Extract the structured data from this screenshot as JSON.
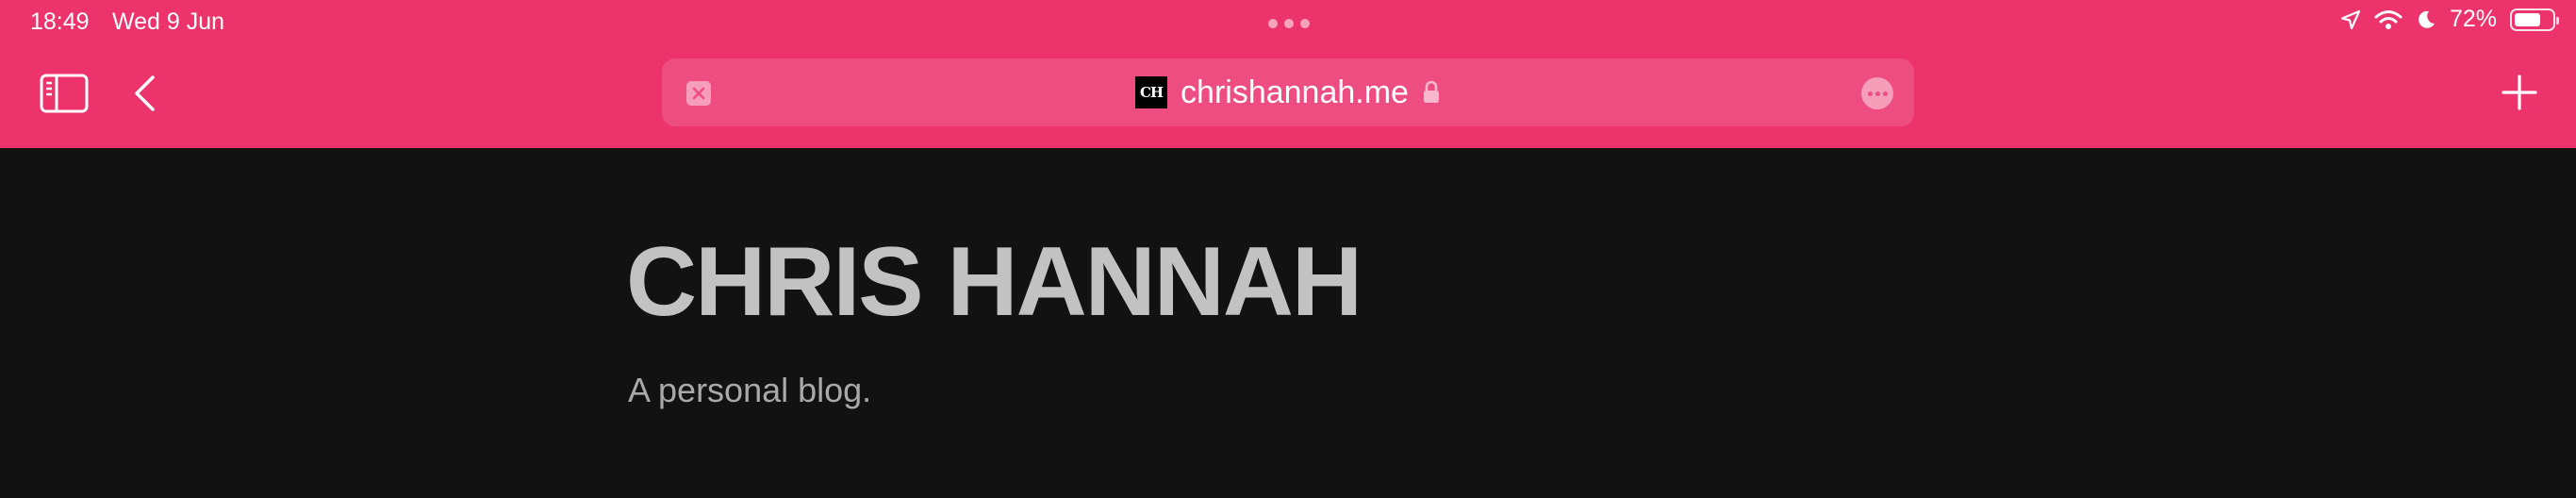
{
  "status_bar": {
    "time": "18:49",
    "date": "Wed 9 Jun",
    "battery_percent": "72%",
    "battery_level": 0.72,
    "icons": [
      "location-icon",
      "wifi-icon",
      "moon-icon",
      "battery-icon"
    ]
  },
  "toolbar": {
    "sidebar_icon": "sidebar-icon",
    "back_icon": "chevron-left-icon",
    "new_tab_icon": "plus-icon"
  },
  "address_bar": {
    "favicon_text": "CH",
    "url": "chrishannah.me",
    "lock_icon": "lock-icon",
    "more_icon": "ellipsis-icon",
    "close_icon": "close-icon"
  },
  "page": {
    "title": "CHRIS HANNAH",
    "tagline": "A personal blog."
  },
  "colors": {
    "chrome": "#ec336b",
    "address_bar": "#ee4d82",
    "page_background": "#121212",
    "title_text": "#c2c2c2"
  }
}
